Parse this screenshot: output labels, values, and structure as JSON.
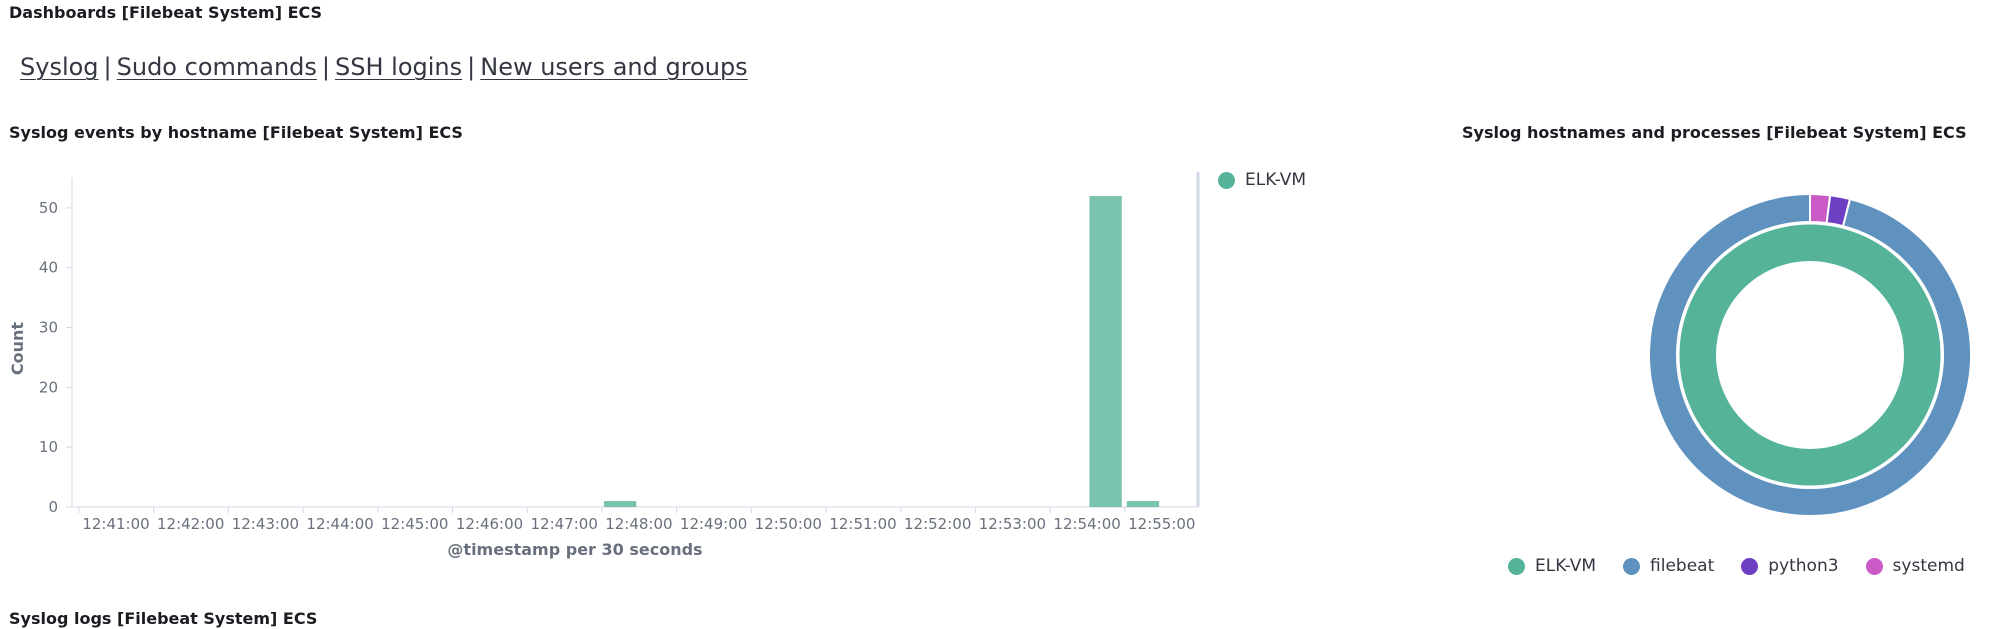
{
  "dashboard_title": "Dashboards [Filebeat System] ECS",
  "nav_links": [
    "Syslog",
    "Sudo commands",
    "SSH logins",
    "New users and groups"
  ],
  "nav_separator": "|",
  "panels": {
    "events_title": "Syslog events by hostname [Filebeat System] ECS",
    "processes_title": "Syslog hostnames and processes [Filebeat System] ECS",
    "logs_title": "Syslog logs [Filebeat System] ECS"
  },
  "colors": {
    "elk_vm": "#54b399",
    "filebeat": "#6092c0",
    "python3": "#6f3fc3",
    "systemd": "#ca5ac6"
  },
  "chart_data": [
    {
      "type": "bar",
      "title": "Syslog events by hostname [Filebeat System] ECS",
      "xlabel": "@timestamp per 30 seconds",
      "ylabel": "Count",
      "ylim": [
        0,
        55
      ],
      "yticks": [
        0,
        10,
        20,
        30,
        40,
        50
      ],
      "xticks": [
        "12:41:00",
        "12:42:00",
        "12:43:00",
        "12:44:00",
        "12:45:00",
        "12:46:00",
        "12:47:00",
        "12:48:00",
        "12:49:00",
        "12:50:00",
        "12:51:00",
        "12:52:00",
        "12:53:00",
        "12:54:00",
        "12:55:00"
      ],
      "series": [
        {
          "name": "ELK-VM",
          "points": [
            {
              "x": "12:48:00",
              "y": 1
            },
            {
              "x": "12:54:30",
              "y": 52
            },
            {
              "x": "12:55:00",
              "y": 1
            }
          ]
        }
      ],
      "legend_position": "right"
    },
    {
      "type": "pie",
      "title": "Syslog hostnames and processes [Filebeat System] ECS",
      "rings": [
        {
          "level": "hostname",
          "slices": [
            {
              "label": "ELK-VM",
              "value": 1.0
            }
          ]
        },
        {
          "level": "process",
          "slices": [
            {
              "label": "systemd",
              "value": 0.02
            },
            {
              "label": "python3",
              "value": 0.02
            },
            {
              "label": "filebeat",
              "value": 0.96
            }
          ]
        }
      ],
      "legend": [
        "ELK-VM",
        "filebeat",
        "python3",
        "systemd"
      ],
      "legend_position": "bottom"
    }
  ]
}
